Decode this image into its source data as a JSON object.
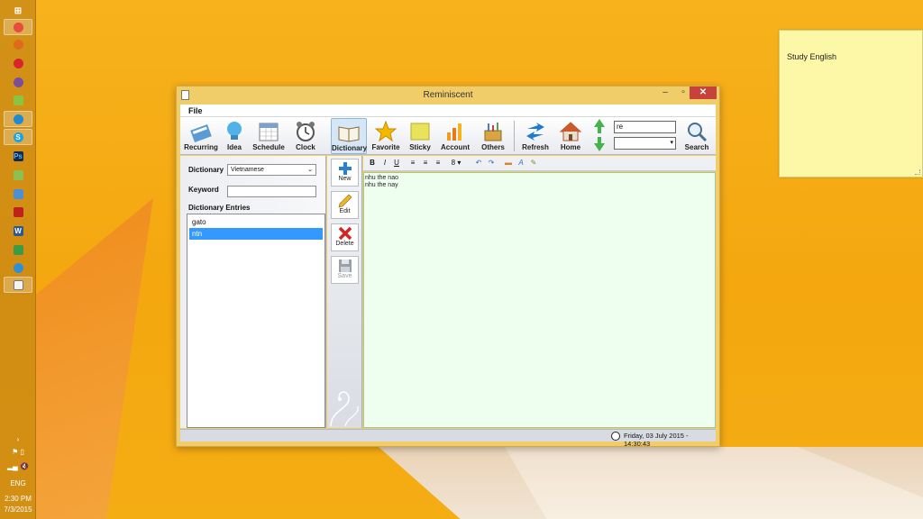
{
  "taskbar": {
    "time": "2:30 PM",
    "date": "7/3/2015",
    "language": "ENG"
  },
  "sticky_note": {
    "text": "Study English"
  },
  "window": {
    "title": "Reminiscent",
    "menu": {
      "file": "File"
    },
    "toolbar": {
      "recurring": "Recurring",
      "idea": "Idea",
      "schedule": "Schedule",
      "clock": "Clock",
      "dictionary": "Dictionary",
      "favorite": "Favorite",
      "sticky": "Sticky",
      "account": "Account",
      "others": "Others",
      "refresh": "Refresh",
      "home": "Home",
      "search": "Search",
      "search_value": "re"
    },
    "left_panel": {
      "dictionary_label": "Dictionary",
      "dictionary_value": "Vietnamese",
      "keyword_label": "Keyword",
      "keyword_value": "",
      "entries_label": "Dictionary Entries",
      "entries": [
        "gato",
        "ntn"
      ],
      "selected_entry": "ntn"
    },
    "actions": {
      "new": "New",
      "edit": "Edit",
      "delete": "Delete",
      "save": "Save"
    },
    "editor_toolbar": {
      "bold": "B",
      "italic": "I",
      "underline": "U",
      "font_size": "8"
    },
    "editor": {
      "lines": [
        "nhu the nao",
        "nhu the nay"
      ]
    },
    "status": {
      "datetime": "Friday, 03 July 2015 - 14:30:43"
    }
  }
}
